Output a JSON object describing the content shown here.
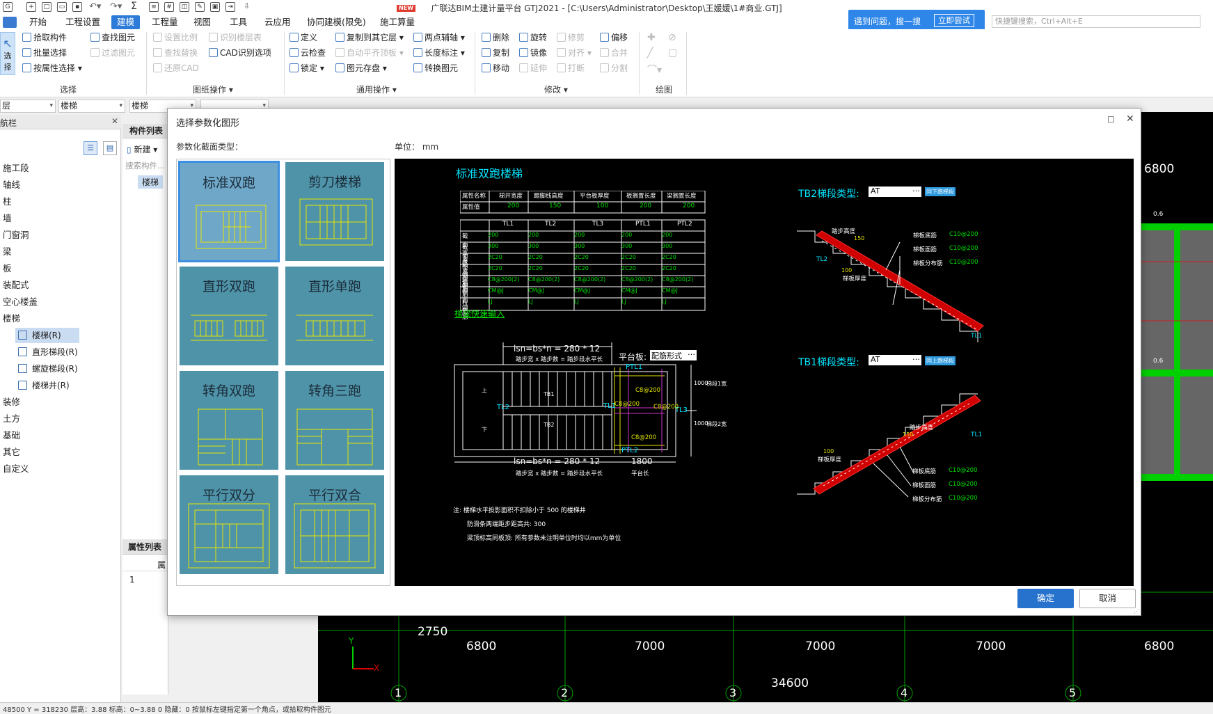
{
  "app": {
    "title": "广联达BIM土建计量平台 GTJ2021 - [C:\\Users\\Administrator\\Desktop\\王媛媛\\1#商业.GTJ]",
    "new_badge": "NEW"
  },
  "menu": [
    "开始",
    "工程设置",
    "建模",
    "工程量",
    "视图",
    "工具",
    "云应用",
    "协同建模(限免)",
    "施工算量"
  ],
  "help": {
    "text": "遇到问题，搜一搜",
    "button": "立即尝试",
    "shortcut_placeholder": "快捷键搜索，Ctrl+Alt+E"
  },
  "ribbon": {
    "select_big": "选择",
    "select_group": {
      "label": "选择",
      "items": [
        "拾取构件",
        "批量选择",
        "按属性选择",
        "查找图元",
        "过滤图元"
      ]
    },
    "drawing_group": {
      "label": "图纸操作 ▾",
      "items": [
        "设置比例",
        "识别楼层表",
        "查找替换",
        "CAD识别选项",
        "还原CAD"
      ]
    },
    "general_group": {
      "label": "通用操作 ▾",
      "items": [
        "定义",
        "复制到其它层 ▾",
        "两点辅轴 ▾",
        "云检查",
        "自动平齐顶板 ▾",
        "长度标注 ▾",
        "锁定 ▾",
        "图元存盘 ▾",
        "转换图元"
      ]
    },
    "modify_group": {
      "label": "修改 ▾",
      "items": [
        "删除",
        "旋转",
        "修剪",
        "偏移",
        "复制",
        "镜像",
        "对齐 ▾",
        "合并",
        "移动",
        "延伸",
        "打断",
        "分割"
      ]
    },
    "draw_group": {
      "label": "绘图"
    }
  },
  "combos": [
    "层",
    "楼梯",
    "楼梯",
    ""
  ],
  "nav": {
    "header": "航栏",
    "items": [
      "施工段",
      "轴线",
      "柱",
      "墙",
      "门窗洞",
      "梁",
      "板",
      "装配式",
      "空心楼盖",
      "楼梯"
    ],
    "sub_items": [
      "楼梯(R)",
      "直形梯段(R)",
      "螺旋梯段(R)",
      "楼梯井(R)"
    ],
    "items_after": [
      "装修",
      "土方",
      "基础",
      "其它",
      "自定义"
    ]
  },
  "component_list": {
    "title": "构件列表",
    "new": "新建 ▾",
    "search": "搜索构件...",
    "item": "楼梯"
  },
  "props_panel": {
    "title": "属性列表",
    "col": "属",
    "row1": "1"
  },
  "cad": {
    "top_dim": "6800",
    "bottom_dims": [
      "2750",
      "6800",
      "7000",
      "7000",
      "7000",
      "6800"
    ],
    "total": "34600",
    "axes": [
      "1",
      "2",
      "3",
      "4",
      "5"
    ],
    "small_label": "0.6"
  },
  "statusbar": {
    "text": "48500 Y = 318230          层高：3.88    标高：0~3.88          0                 隐藏：0                                        按鼠标左键指定第一个角点，或拾取构件图元"
  },
  "dialog": {
    "title": "选择参数化图形",
    "type_label": "参数化截面类型：",
    "unit_label": "单位：  mm",
    "ok": "确定",
    "cancel": "取消",
    "shapes": [
      "标准双跑",
      "剪刀楼梯",
      "直形双跑",
      "直形单跑",
      "转角双跑",
      "转角三跑",
      "平行双分",
      "平行双合"
    ],
    "selected": 0
  },
  "preview": {
    "title": "标准双跑楼梯",
    "attr_headers": [
      "属性名称",
      "梯井宽度",
      "踢脚线高度",
      "平台板厚度",
      "板搁置长度",
      "梁搁置长度"
    ],
    "attr_values": [
      "属性值",
      "200",
      "150",
      "100",
      "200",
      "200"
    ],
    "beam_headers": [
      "",
      "TL1",
      "TL2",
      "TL3",
      "PTL1",
      "PTL2"
    ],
    "beam_rows": [
      [
        "截面宽度",
        "200",
        "200",
        "200",
        "200",
        "200"
      ],
      [
        "截面高度",
        "300",
        "300",
        "300",
        "300",
        "300"
      ],
      [
        "上部钢筋",
        "2C20",
        "2C20",
        "2C20",
        "2C20",
        "2C20"
      ],
      [
        "下部钢筋",
        "2C20",
        "2C20",
        "2C20",
        "2C20",
        "2C20"
      ],
      [
        "箍筋",
        "C8@200(2)",
        "C8@200(2)",
        "C8@200(2)",
        "C8@200(2)",
        "C8@200(2)"
      ],
      [
        "侧面钢筋",
        "CM@J",
        "CM@J",
        "CM@J",
        "CM@J",
        "CM@J"
      ],
      [
        "拉筋",
        "LJ",
        "LJ",
        "LJ",
        "LJ",
        "LJ"
      ]
    ],
    "quick_input": "梯梁快速输入",
    "lsn_top": "lsn=bs*n = 280 * 12",
    "lsn_top_sub": "踏步宽 x 踏步数 = 踏步段水平长",
    "platform_label": "平台板:",
    "platform_value": "配筋形式",
    "lsn_bottom": "lsn=bs*n = 280 * 12",
    "lsn_bottom_sub": "踏步宽 x 踏步数 = 踏步段水平长",
    "platform_len": "1800",
    "platform_len_sub": "平台长",
    "plan_labels": {
      "tb1": "TB1",
      "tb2": "TB2",
      "tl1": "TL1",
      "tl2": "TL2",
      "tl3": "TL3",
      "ptl1": "PTL1",
      "ptl2": "PTL2",
      "c8_1": "C8@200",
      "c8_2": "C8@200",
      "c8_3": "C8@200",
      "c8_4": "C8@200",
      "up": "上",
      "down": "下",
      "w1": "1000",
      "w2": "1000",
      "wl1": "梯段1宽",
      "wl2": "梯段2宽"
    },
    "notes": [
      "注: 楼梯水平投影面积不扣除小于 500  的楼梯井",
      "防滑条两端距步距高共: 300",
      "梁顶标高同板顶: 所有参数未注明单位时均以mm为单位"
    ],
    "tb2": {
      "label": "TB2梯段类型:",
      "value": "AT",
      "button": "同下跑梯段",
      "step_h": "踏步高度",
      "h150": "150",
      "w100": "100",
      "thick": "梯板厚度",
      "tl2": "TL2",
      "tl1": "TL1",
      "r1": "梯板底筋",
      "r2": "梯板面筋",
      "r3": "梯板分布筋",
      "v1": "C10@200",
      "v2": "C10@200",
      "v3": "C10@200"
    },
    "tb1": {
      "label": "TB1梯段类型:",
      "value": "AT",
      "button": "同上跑梯段",
      "step_h": "踏步高度",
      "h150": "150",
      "w100": "100",
      "thick": "梯板厚度",
      "tl1": "TL1",
      "r1": "梯板底筋",
      "r2": "梯板面筋",
      "r3": "梯板分布筋",
      "v1": "C10@200",
      "v2": "C10@200",
      "v3": "C10@200"
    }
  }
}
